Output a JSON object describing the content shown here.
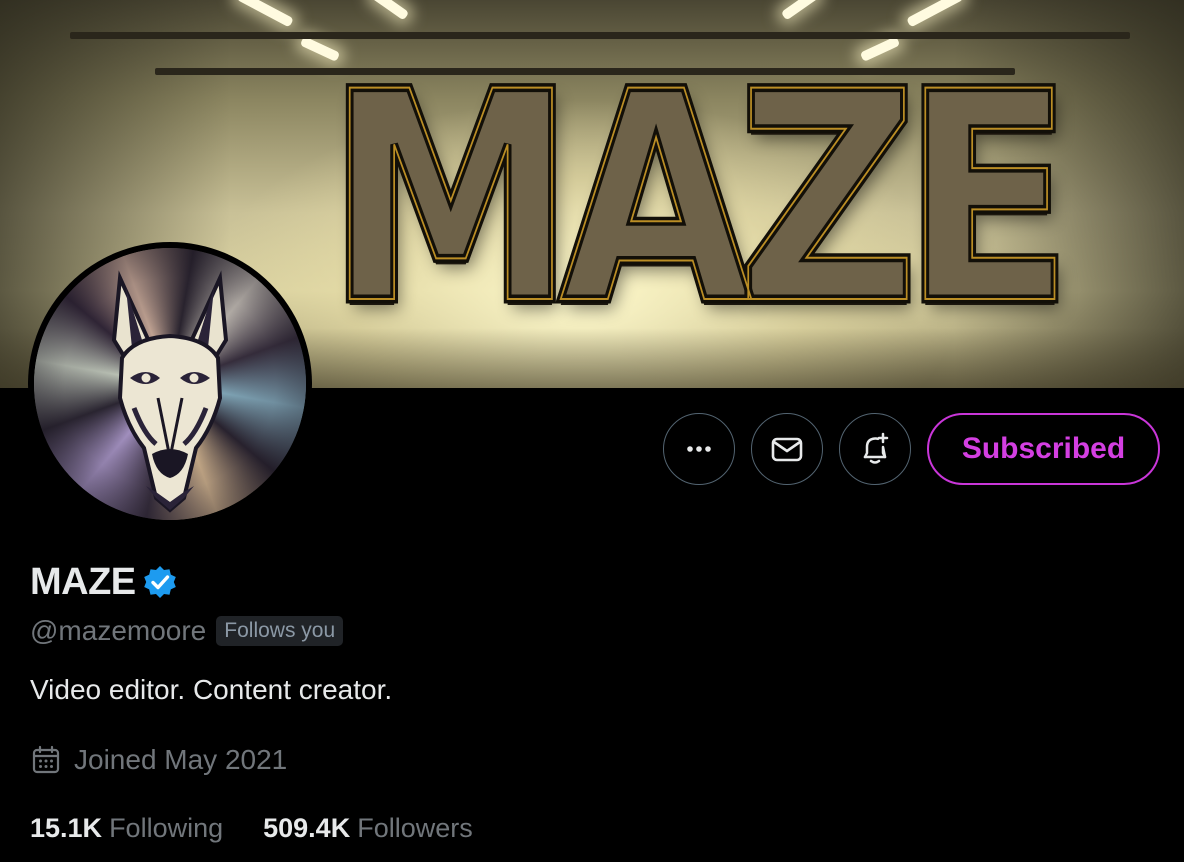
{
  "profile": {
    "banner_logo_text": "MAZE",
    "display_name": "MAZE",
    "verified": true,
    "handle": "@mazemoore",
    "follows_you_badge": "Follows you",
    "bio": "Video editor. Content creator.",
    "joined": "Joined May 2021",
    "following_count": "15.1K",
    "following_label": "Following",
    "followers_count": "509.4K",
    "followers_label": "Followers"
  },
  "actions": {
    "more_icon": "more-horizontal-icon",
    "message_icon": "envelope-icon",
    "notify_icon": "bell-plus-icon",
    "subscribed_label": "Subscribed"
  },
  "colors": {
    "background": "#000000",
    "text_primary": "#e7e9ea",
    "text_secondary": "#71767b",
    "verified_blue": "#1d9bf0",
    "subscribed_accent": "#d43fe2",
    "button_border": "#536471"
  }
}
